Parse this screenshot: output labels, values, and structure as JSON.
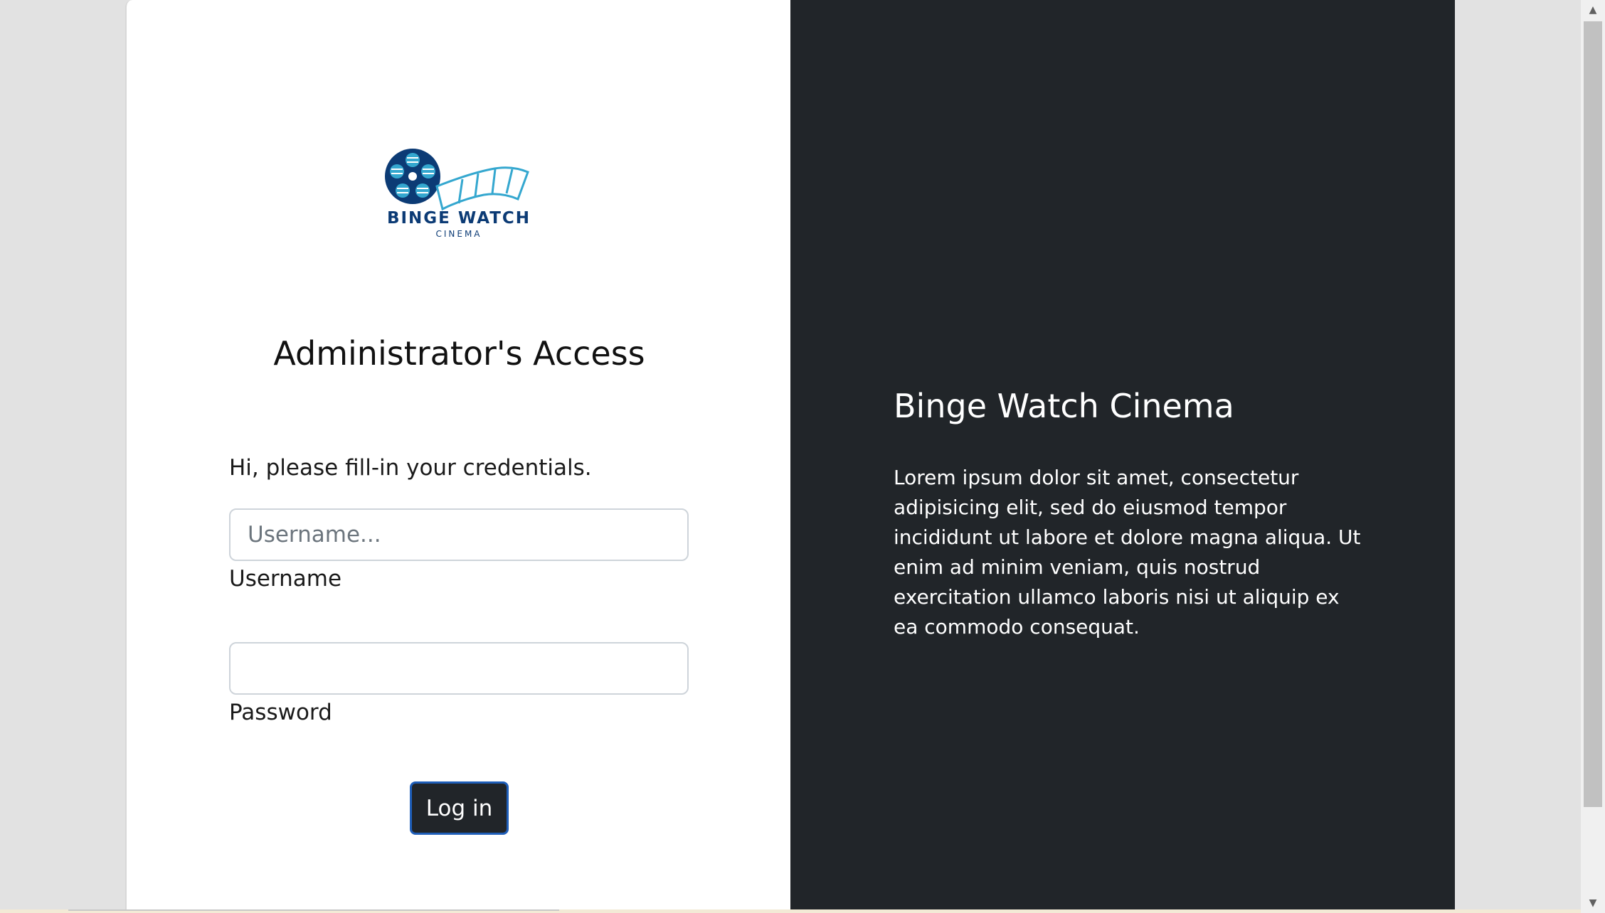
{
  "brand": {
    "logo_name": "BINGE WATCH",
    "logo_subtitle": "CINEMA",
    "colors": {
      "logo_dark": "#0c3b75",
      "logo_light": "#34a7cf"
    }
  },
  "login": {
    "title": "Administrator's Access",
    "intro": "Hi, please fill-in your credentials.",
    "username": {
      "placeholder": "Username...",
      "value": "",
      "label": "Username"
    },
    "password": {
      "placeholder": "",
      "value": "",
      "label": "Password"
    },
    "submit_label": "Log in"
  },
  "info": {
    "title": "Binge Watch Cinema",
    "text": "Lorem ipsum dolor sit amet, consectetur adipisicing elit, sed do eiusmod tempor incididunt ut labore et dolore magna aliqua. Ut enim ad minim veniam, quis nostrud exercitation ullamco laboris nisi ut aliquip ex ea commodo consequat."
  },
  "colors": {
    "dark_panel": "#212529",
    "button_border": "#1f5eb8",
    "page_background": "#e2e2e2"
  },
  "scrollbar": {
    "up_icon": "▲",
    "down_icon": "▼"
  }
}
